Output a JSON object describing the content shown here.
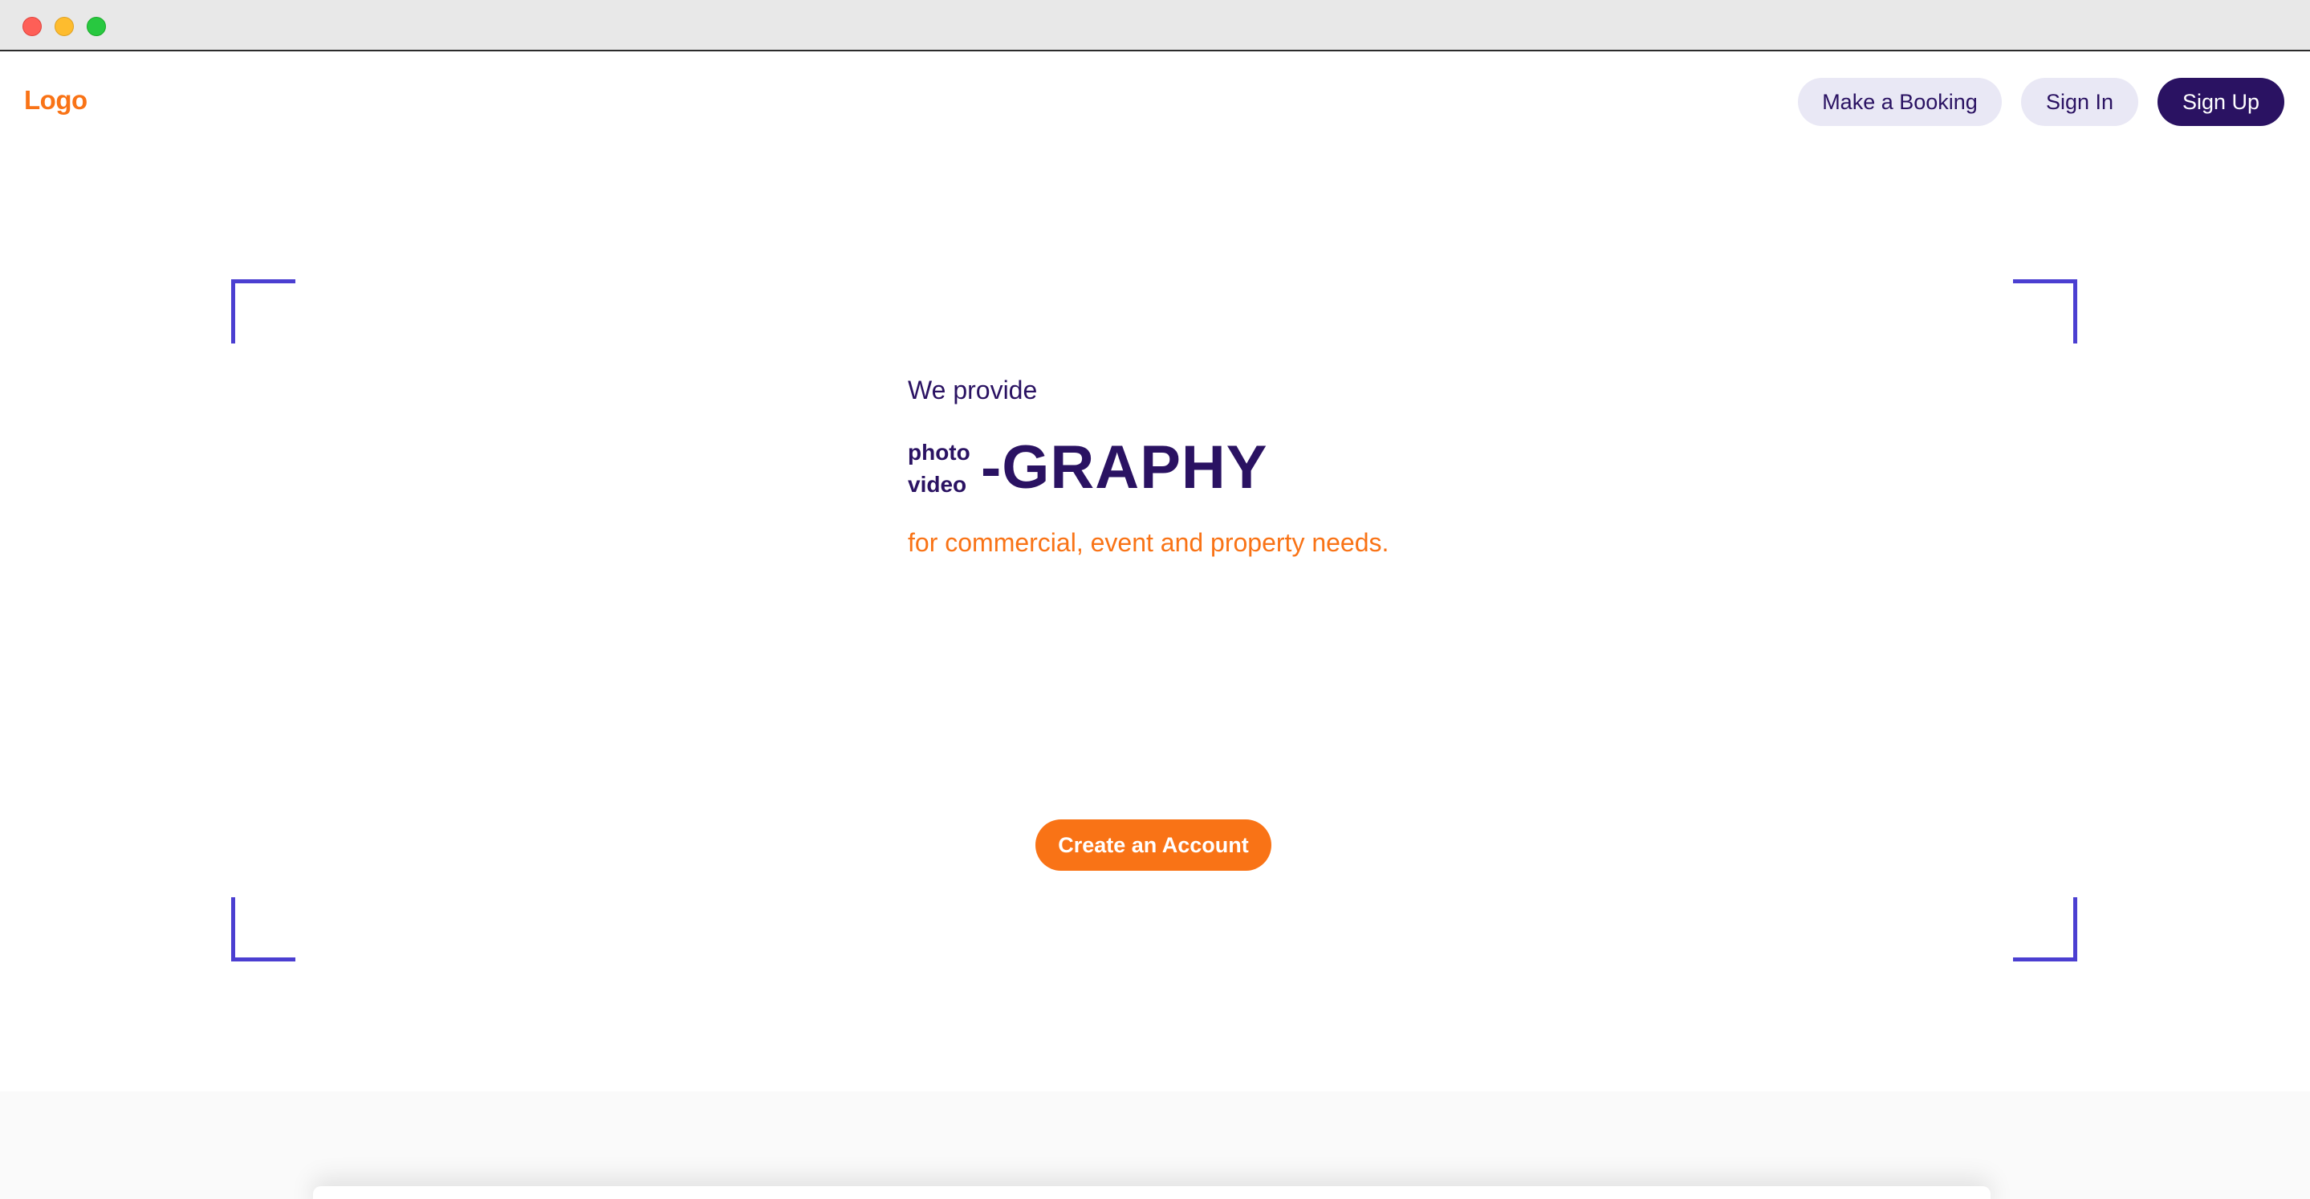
{
  "window": {
    "controls": [
      "close",
      "minimize",
      "maximize"
    ]
  },
  "nav": {
    "logo": "Logo",
    "make_booking": "Make a Booking",
    "sign_in": "Sign In",
    "sign_up": "Sign Up"
  },
  "hero": {
    "intro": "We provide",
    "prefix_top": "photo",
    "prefix_bottom": "video",
    "suffix": "-GRAPHY",
    "tagline": "for commercial, event and property needs.",
    "cta": "Create an Account"
  },
  "colors": {
    "accent_orange": "#f97316",
    "brand_dark_purple": "#2a1262",
    "pill_light": "#e9e8f5",
    "bracket_purple": "#4b3fd1"
  }
}
